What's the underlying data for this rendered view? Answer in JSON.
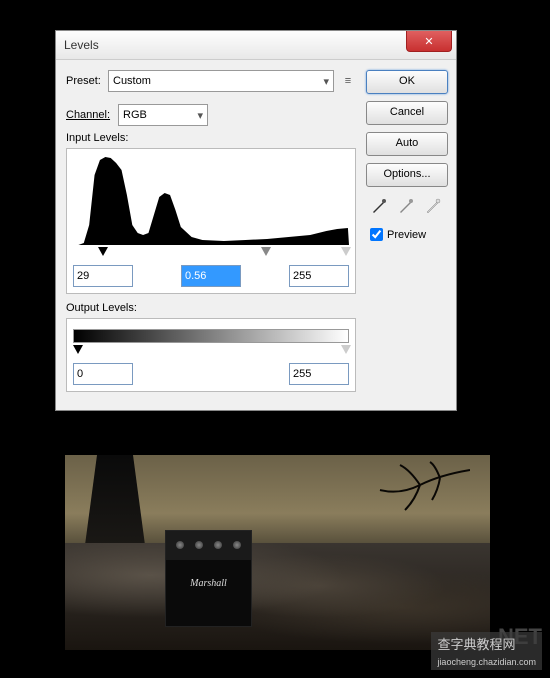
{
  "dialog": {
    "title": "Levels",
    "preset_label": "Preset:",
    "preset_value": "Custom",
    "channel_label": "Channel:",
    "channel_value": "RGB",
    "input_levels_label": "Input Levels:",
    "output_levels_label": "Output Levels:",
    "input_black": "29",
    "input_gamma": "0.56",
    "input_white": "255",
    "output_black": "0",
    "output_white": "255",
    "buttons": {
      "ok": "OK",
      "cancel": "Cancel",
      "auto": "Auto",
      "options": "Options..."
    },
    "preview_label": "Preview",
    "preview_checked": true
  },
  "amp_brand": "Marshall",
  "watermark_main": "查字典教程网",
  "watermark_url": "jiaocheng.chazidian.com",
  "watermark_bg": "NET"
}
